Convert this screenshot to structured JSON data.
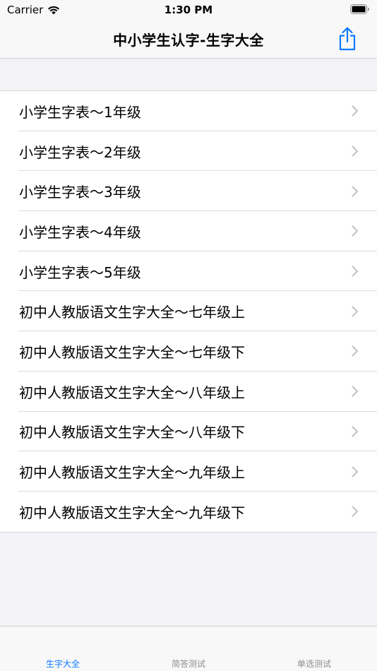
{
  "status_bar": {
    "carrier": "Carrier",
    "time": "1:30 PM"
  },
  "nav": {
    "title": "中小学生认字-生字大全",
    "share_icon": "share-icon"
  },
  "list": {
    "items": [
      {
        "label": "小学生字表～1年级"
      },
      {
        "label": "小学生字表～2年级"
      },
      {
        "label": "小学生字表～3年级"
      },
      {
        "label": "小学生字表～4年级"
      },
      {
        "label": "小学生字表～5年级"
      },
      {
        "label": "初中人教版语文生字大全～七年级上"
      },
      {
        "label": "初中人教版语文生字大全～七年级下"
      },
      {
        "label": "初中人教版语文生字大全～八年级上"
      },
      {
        "label": "初中人教版语文生字大全～八年级下"
      },
      {
        "label": "初中人教版语文生字大全～九年级上"
      },
      {
        "label": "初中人教版语文生字大全～九年级下"
      }
    ]
  },
  "tab_bar": {
    "tabs": [
      {
        "label": "生字大全",
        "active": true
      },
      {
        "label": "简答测试",
        "active": false
      },
      {
        "label": "单选测试",
        "active": false
      }
    ]
  },
  "colors": {
    "accent": "#0a7aff",
    "background": "#f2f2f7",
    "chevron": "#c4c4c7",
    "tab_inactive": "#8e8e93"
  }
}
